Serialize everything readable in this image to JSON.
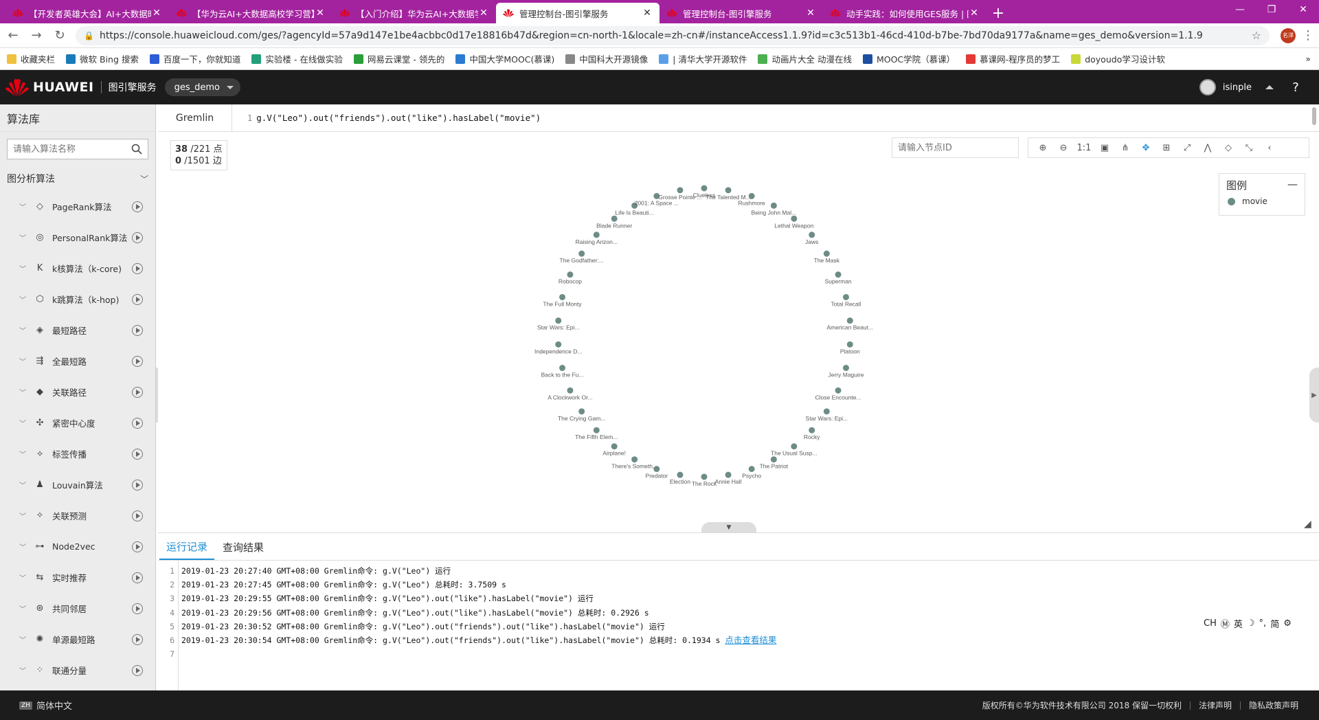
{
  "browser": {
    "tabs": [
      {
        "title": "【开发者英雄大会】AI+大数据时",
        "active": false
      },
      {
        "title": "【华为云AI+大数据高校学习营】",
        "active": false
      },
      {
        "title": "【入门介绍】华为云AI+大数据学",
        "active": false
      },
      {
        "title": "管理控制台-图引擎服务",
        "active": true
      },
      {
        "title": "管理控制台-图引擎服务",
        "active": false
      },
      {
        "title": "动手实践：如何使用GES服务 | 图",
        "active": false
      }
    ],
    "url": "https://console.huaweicloud.com/ges/?agencyId=57a9d147e1be4acbbc0d17e18816b47d&region=cn-north-1&locale=zh-cn#/instanceAccess1.1.9?id=c3c513b1-46cd-410d-b7be-7bd70da9177a&name=ges_demo&version=1.1.9",
    "profile_label": "名洋",
    "bookmarks": [
      {
        "label": "收藏夹栏",
        "color": "#f0c040"
      },
      {
        "label": "微软 Bing 搜索",
        "color": "#1a7bb9"
      },
      {
        "label": "百度一下，你就知道",
        "color": "#2e5cd8"
      },
      {
        "label": "实验楼 - 在线做实验",
        "color": "#22a07a"
      },
      {
        "label": "网易云课堂 - 领先的",
        "color": "#2a9e3a"
      },
      {
        "label": "中国大学MOOC(慕课)",
        "color": "#2c7bd2"
      },
      {
        "label": "中国科大开源镜像",
        "color": "#888888"
      },
      {
        "label": "| 清华大学开源软件",
        "color": "#5aa0e8"
      },
      {
        "label": "动画片大全 动漫在线",
        "color": "#4caf50"
      },
      {
        "label": "MOOC学院（慕课）",
        "color": "#1d4fa0"
      },
      {
        "label": "慕课网-程序员的梦工",
        "color": "#e53935"
      },
      {
        "label": "doyoudo学习设计软",
        "color": "#c8d838"
      }
    ]
  },
  "header": {
    "logo_text": "HUAWEI",
    "service_name": "图引擎服务",
    "instance_name": "ges_demo",
    "username": "isinple",
    "help_glyph": "?"
  },
  "sidebar": {
    "title": "算法库",
    "search_placeholder": "请输入算法名称",
    "group_label": "图分析算法",
    "items": [
      {
        "label": "PageRank算法",
        "icon": "pagerank-icon"
      },
      {
        "label": "PersonalRank算法",
        "icon": "personalrank-icon"
      },
      {
        "label": "k核算法（k-core)",
        "icon": "kcore-icon"
      },
      {
        "label": "k跳算法（k-hop)",
        "icon": "khop-icon"
      },
      {
        "label": "最短路径",
        "icon": "shortest-path-icon"
      },
      {
        "label": "全最短路",
        "icon": "all-shortest-paths-icon"
      },
      {
        "label": "关联路径",
        "icon": "related-path-icon"
      },
      {
        "label": "紧密中心度",
        "icon": "closeness-icon"
      },
      {
        "label": "标签传播",
        "icon": "label-propagation-icon"
      },
      {
        "label": "Louvain算法",
        "icon": "louvain-icon"
      },
      {
        "label": "关联预测",
        "icon": "link-prediction-icon"
      },
      {
        "label": "Node2vec",
        "icon": "node2vec-icon"
      },
      {
        "label": "实时推荐",
        "icon": "realtime-recommend-icon"
      },
      {
        "label": "共同邻居",
        "icon": "common-neighbors-icon"
      },
      {
        "label": "单源最短路",
        "icon": "sssp-icon"
      },
      {
        "label": "联通分量",
        "icon": "connected-components-icon"
      }
    ]
  },
  "query": {
    "tab_label": "Gremlin",
    "line_number": "1",
    "text": "g.V(\"Leo\").out(\"friends\").out(\"like\").hasLabel(\"movie\")"
  },
  "graph": {
    "points_shown": "38",
    "points_total": "/221 点",
    "edges_shown": "0",
    "edges_total": "/1501 边",
    "node_search_placeholder": "请输入节点ID",
    "zoom_label": "1:1",
    "legend_title": "图例",
    "legend_collapse": "—",
    "legend_items": [
      {
        "label": "movie",
        "color": "#6e8c87"
      }
    ],
    "nodes": [
      "Clueless",
      "The Talented M...",
      "Rushmore",
      "Being John Mal...",
      "Lethal Weapon",
      "Jaws",
      "The Mask",
      "Superman",
      "Total Recall",
      "American Beaut...",
      "Platoon",
      "Jerry Maguire",
      "Close Encounte...",
      "Star Wars: Epi...",
      "Rocky",
      "The Usual Susp...",
      "The Patriot",
      "Psycho",
      "Annie Hall",
      "The Rock",
      "Election",
      "Predator",
      "There's Someth...",
      "Airplane!",
      "The Fifth Elem...",
      "The Crying Gam...",
      "A Clockwork Or...",
      "Back to the Fu...",
      "Independence D...",
      "Star Wars: Epi...",
      "The Full Monty",
      "Robocop",
      "The Godfather:...",
      "Raising Arizon...",
      "Blade Runner",
      "Life Is Beauti...",
      "2001: A Space ...",
      "Grosse Pointe ..."
    ]
  },
  "log": {
    "tabs": [
      {
        "label": "运行记录",
        "active": true
      },
      {
        "label": "查询结果",
        "active": false
      }
    ],
    "lines": [
      "2019-01-23 20:27:40 GMT+08:00 Gremlin命令: g.V(\"Leo\") 运行",
      "2019-01-23 20:27:45 GMT+08:00 Gremlin命令: g.V(\"Leo\") 总耗时: 3.7509 s",
      "2019-01-23 20:29:55 GMT+08:00 Gremlin命令: g.V(\"Leo\").out(\"like\").hasLabel(\"movie\") 运行",
      "2019-01-23 20:29:56 GMT+08:00 Gremlin命令: g.V(\"Leo\").out(\"like\").hasLabel(\"movie\") 总耗时: 0.2926 s",
      "2019-01-23 20:30:52 GMT+08:00 Gremlin命令: g.V(\"Leo\").out(\"friends\").out(\"like\").hasLabel(\"movie\") 运行",
      "2019-01-23 20:30:54 GMT+08:00 Gremlin命令: g.V(\"Leo\").out(\"friends\").out(\"like\").hasLabel(\"movie\") 总耗时: 0.1934 s ",
      ""
    ],
    "result_link": "点击查看结果"
  },
  "ime": {
    "mode": "CH",
    "lang": "英",
    "script": "简"
  },
  "footer": {
    "language": "简体中文",
    "lang_badge": "ZH",
    "copyright": "版权所有©华为软件技术有限公司 2018 保留一切权利",
    "legal": "法律声明",
    "privacy": "隐私政策声明"
  },
  "colors": {
    "tabbar": "#a3239f",
    "accent": "#1f8fd6",
    "node": "#6e8c87",
    "header_bg": "#1c1c1c"
  }
}
